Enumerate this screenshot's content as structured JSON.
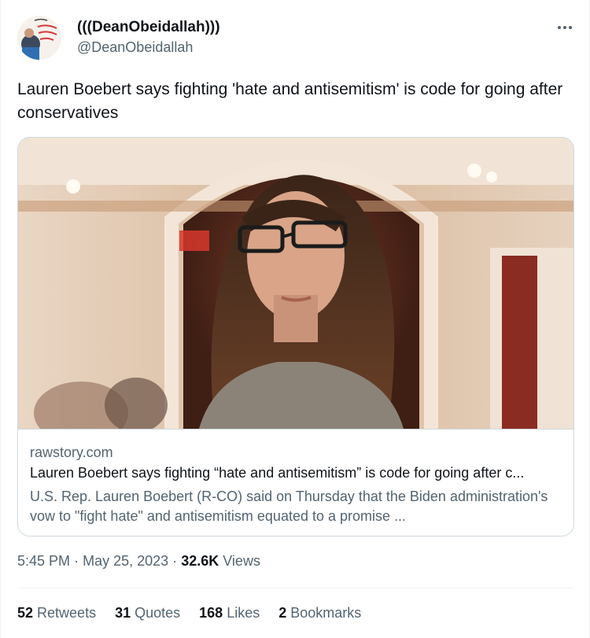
{
  "author": {
    "display_name": "(((DeanObeidallah)))",
    "handle": "@DeanObeidallah"
  },
  "more_icon": "more-horizontal-icon",
  "tweet": {
    "text": "Lauren Boebert says fighting 'hate and antisemitism' is code for going after conservatives"
  },
  "card": {
    "domain": "rawstory.com",
    "title": "Lauren Boebert says fighting “hate and antisemitism” is code for going after c...",
    "description": "U.S. Rep. Lauren Boebert (R-CO) said on Thursday that the Biden administration's vow to \"fight hate\" and antisemitism equated to a promise ..."
  },
  "meta": {
    "time": "5:45 PM",
    "separator": "·",
    "date": "May 25, 2023",
    "views_count": "32.6K",
    "views_label": "Views"
  },
  "stats": {
    "retweets_count": "52",
    "retweets_label": "Retweets",
    "quotes_count": "31",
    "quotes_label": "Quotes",
    "likes_count": "168",
    "likes_label": "Likes",
    "bookmarks_count": "2",
    "bookmarks_label": "Bookmarks"
  },
  "colors": {
    "text_primary": "#0f1419",
    "text_secondary": "#536471",
    "border": "#cfd9de"
  }
}
